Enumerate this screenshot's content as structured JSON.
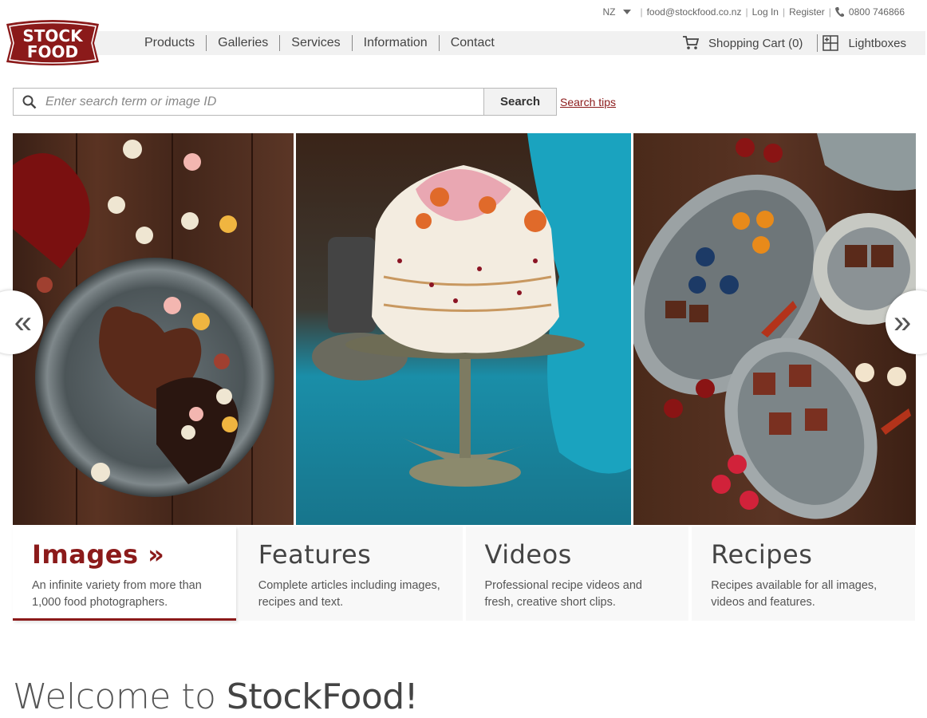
{
  "utility": {
    "country": "NZ",
    "email": "food@stockfood.co.nz",
    "login": "Log In",
    "register": "Register",
    "phone": "0800 746866"
  },
  "logo": {
    "line1": "STOCK",
    "line2": "FOOD"
  },
  "nav": {
    "items": [
      "Products",
      "Galleries",
      "Services",
      "Information",
      "Contact"
    ],
    "cart": "Shopping Cart (0)",
    "lightboxes": "Lightboxes"
  },
  "search": {
    "placeholder": "Enter search term or image ID",
    "button": "Search",
    "tips": "Search tips"
  },
  "carousel": {
    "prev": "«",
    "next": "»",
    "slides": [
      "chocolate hearts on pewter plate",
      "pavlova on cake stand",
      "chocolates on silver trays"
    ]
  },
  "categories": [
    {
      "title": "Images »",
      "text": "An infinite variety from more than 1,000 food photographers.",
      "active": true
    },
    {
      "title": "Features",
      "text": "Complete articles including images, recipes and text.",
      "active": false
    },
    {
      "title": "Videos",
      "text": "Professional recipe videos and fresh, creative short clips.",
      "active": false
    },
    {
      "title": "Recipes",
      "text": "Recipes available for all images, videos and features.",
      "active": false
    }
  ],
  "welcome": {
    "prefix": "Welcome to ",
    "brand": "StockFood!"
  },
  "colors": {
    "brand_red": "#8b1a1a",
    "nav_band": "#f1f1f1"
  }
}
